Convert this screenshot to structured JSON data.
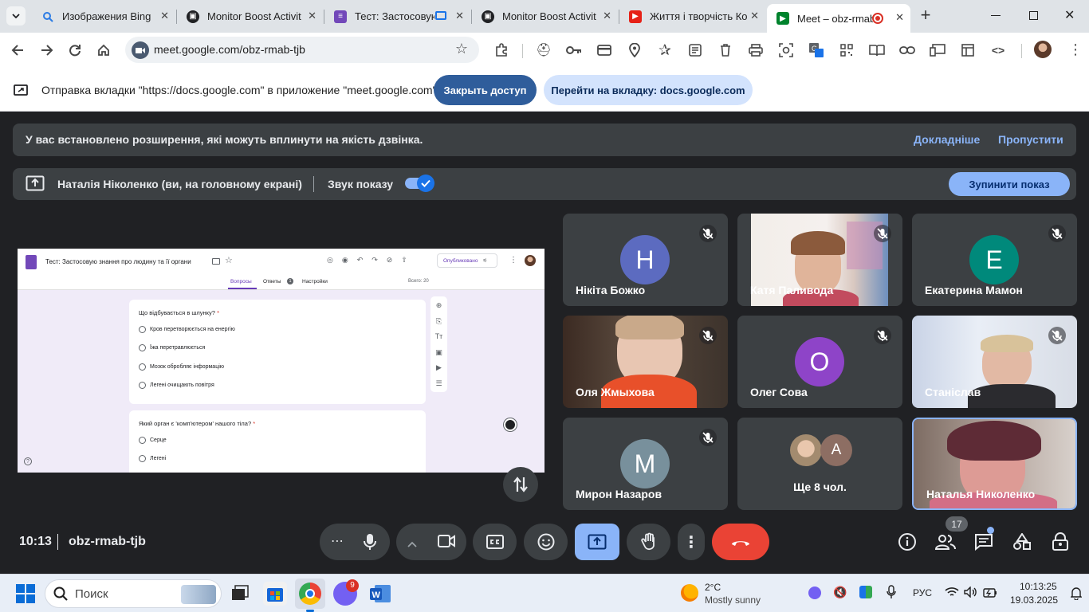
{
  "tabs": [
    {
      "title": "Изображения Bing",
      "color": "#2b7be4"
    },
    {
      "title": "Monitor Boost Activit",
      "color": "#202124"
    },
    {
      "title": "Тест: Застосовую",
      "color": "#7248b9"
    },
    {
      "title": "Monitor Boost Activit",
      "color": "#202124"
    },
    {
      "title": "Життя і творчість Ко",
      "color": "#e62117"
    },
    {
      "title": "Meet – obz-rmab",
      "color": "#00832d"
    }
  ],
  "address": {
    "url": "meet.google.com/obz-rmab-tjb"
  },
  "infobar": {
    "message": "Отправка вкладки \"https://docs.google.com\" в приложение \"meet.google.com\"...",
    "stop_label": "Закрыть доступ",
    "switch_label": "Перейти на вкладку: docs.google.com"
  },
  "banner_ext": {
    "message": "У вас встановлено розширення, які можуть вплинути на якість дзвінка.",
    "learn_more": "Докладніше",
    "skip": "Пропустити"
  },
  "presenting": {
    "who": "Наталія Ніколенко (ви, на головному екрані)",
    "sound": "Звук показу",
    "stop": "Зупинити показ"
  },
  "shared_form": {
    "title": "Тест: Застосовую знання про людину та її органи",
    "published": "Опубликовано",
    "tabs": [
      "Вопросы",
      "Ответы",
      "Настройки"
    ],
    "answers_count": "1",
    "total": "Всего: 20",
    "q1": {
      "text": "Що відбувається в шлунку?",
      "options": [
        "Кров перетворюється на енергію",
        "Їжа перетравлюється",
        "Мозок обробляє інформацію",
        "Легені очищають повітря"
      ]
    },
    "q2": {
      "text": "Який орган є 'комп'ютером' нашого тіла?",
      "options": [
        "Серце",
        "Легені"
      ]
    }
  },
  "participants": [
    {
      "name": "Нікіта Божко",
      "initial": "Н",
      "color": "#5c6bc0"
    },
    {
      "name": "Катя Паливода"
    },
    {
      "name": "Екатерина Мамон",
      "initial": "Е",
      "color": "#00897b"
    },
    {
      "name": "Оля Жмыхова"
    },
    {
      "name": "Олег Сова",
      "initial": "О",
      "color": "#8e44c8"
    },
    {
      "name": "Станіслав"
    },
    {
      "name": "Мирон Назаров",
      "initial": "М",
      "color": "#78909c"
    },
    {
      "name": "Ще 8 чол.",
      "initial": "А",
      "color": "#8d6e63"
    },
    {
      "name": "Наталья Николенко"
    }
  ],
  "meeting": {
    "time": "10:13",
    "code": "obz-rmab-tjb",
    "people_count": "17"
  },
  "taskbar": {
    "search": "Поиск",
    "weather_temp": "2°C",
    "weather_text": "Mostly sunny",
    "lang": "РУС",
    "clock_time": "10:13:25",
    "clock_date": "19.03.2025",
    "viber_badge": "9"
  }
}
